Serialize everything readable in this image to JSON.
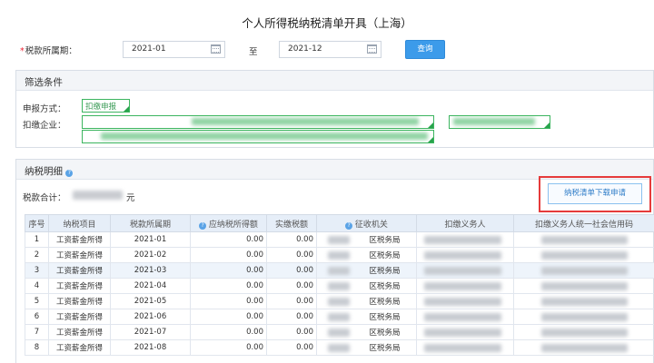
{
  "title": "个人所得税纳税清单开具（上海）",
  "period": {
    "required_mark": "*",
    "label": "税款所属期：",
    "start": "2021-01",
    "sep": "至",
    "end": "2021-12"
  },
  "query_label": "查询",
  "filter": {
    "heading": "筛选条件",
    "method_label": "申报方式：",
    "method_value": "扣缴申报",
    "company_label": "扣缴企业："
  },
  "detail": {
    "heading": "纳税明细",
    "total_label": "税款合计：",
    "total_unit": "元",
    "download_label": "纳税清单下载申请"
  },
  "columns": [
    "序号",
    "纳税项目",
    "税款所属期",
    "应纳税所得额",
    "实缴税额",
    "征收机关",
    "扣缴义务人",
    "扣缴义务人统一社会信用码"
  ],
  "rows": [
    {
      "no": "1",
      "item": "工资薪金所得",
      "period": "2021-01",
      "taxable": "0.00",
      "paid": "0.00",
      "authority": "区税务局"
    },
    {
      "no": "2",
      "item": "工资薪金所得",
      "period": "2021-02",
      "taxable": "0.00",
      "paid": "0.00",
      "authority": "区税务局"
    },
    {
      "no": "3",
      "item": "工资薪金所得",
      "period": "2021-03",
      "taxable": "0.00",
      "paid": "0.00",
      "authority": "区税务局"
    },
    {
      "no": "4",
      "item": "工资薪金所得",
      "period": "2021-04",
      "taxable": "0.00",
      "paid": "0.00",
      "authority": "区税务局"
    },
    {
      "no": "5",
      "item": "工资薪金所得",
      "period": "2021-05",
      "taxable": "0.00",
      "paid": "0.00",
      "authority": "区税务局"
    },
    {
      "no": "6",
      "item": "工资薪金所得",
      "period": "2021-06",
      "taxable": "0.00",
      "paid": "0.00",
      "authority": "区税务局"
    },
    {
      "no": "7",
      "item": "工资薪金所得",
      "period": "2021-07",
      "taxable": "0.00",
      "paid": "0.00",
      "authority": "区税务局"
    },
    {
      "no": "8",
      "item": "工资薪金所得",
      "period": "2021-08",
      "taxable": "0.00",
      "paid": "0.00",
      "authority": "区税务局"
    }
  ],
  "colors": {
    "accent": "#3c9bea",
    "highlight": "#e53b3b",
    "tag": "#3cb55f"
  }
}
